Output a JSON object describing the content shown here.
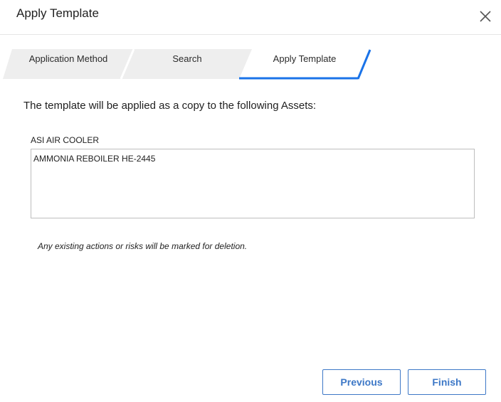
{
  "dialog": {
    "title": "Apply Template"
  },
  "wizard": {
    "steps": [
      {
        "label": "Application Method",
        "active": false
      },
      {
        "label": "Search",
        "active": false
      },
      {
        "label": "Apply Template",
        "active": true
      }
    ],
    "active_color": "#1a73e8",
    "inactive_fill": "#eeeeee"
  },
  "content": {
    "intro": "The template will be applied as a copy to the following Assets:",
    "assets_label": "ASI AIR COOLER",
    "assets_list": "AMMONIA REBOILER HE-2445",
    "note": "Any existing actions or risks will be marked for deletion."
  },
  "footer": {
    "previous_label": "Previous",
    "finish_label": "Finish",
    "button_color": "#3d78c7"
  }
}
